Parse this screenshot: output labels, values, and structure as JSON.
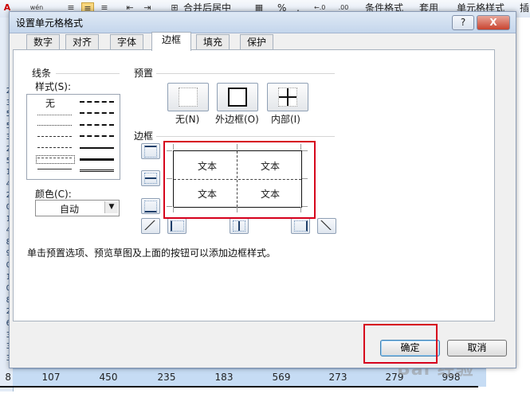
{
  "ribbon": {
    "font_color_icon": "A",
    "merge_label": "合并后居中",
    "percent": "%",
    "comma": ",",
    "conditional_format": "条件格式",
    "apply": "套用",
    "cell_style": "单元格样式",
    "insert": "插"
  },
  "row_numbers": [
    "2",
    "3",
    "5",
    "5",
    "3",
    "2",
    "5",
    "1",
    "4",
    "2",
    "0",
    "1",
    "4",
    "8",
    "9",
    "0",
    "1",
    "0",
    "8",
    "2",
    "6",
    "3",
    "3",
    "3"
  ],
  "sheet": {
    "bottom_row_number": "8",
    "bottom_values": [
      "107",
      "450",
      "235",
      "183",
      "569",
      "273",
      "279",
      "998"
    ],
    "watermark": "Bai 经验"
  },
  "dialog": {
    "title": "设置单元格格式",
    "help_button": "?",
    "close_button": "X",
    "tabs": [
      "数字",
      "对齐",
      "字体",
      "边框",
      "填充",
      "保护"
    ],
    "active_tab": "边框",
    "line_group": "线条",
    "style_label": "样式(S):",
    "style_none": "无",
    "color_label": "颜色(C):",
    "color_value": "自动",
    "preset_group": "预置",
    "presets": [
      "无(N)",
      "外边框(O)",
      "内部(I)"
    ],
    "border_group": "边框",
    "preview_text": [
      "文本",
      "文本",
      "文本",
      "文本"
    ],
    "hint": "单击预置选项、预览草图及上面的按钮可以添加边框样式。",
    "ok": "确定",
    "cancel": "取消"
  },
  "colors": {
    "annotation_red": "#d6001c",
    "selected_row": "#c6dcf4",
    "title_bar": "#c4d6ec"
  }
}
